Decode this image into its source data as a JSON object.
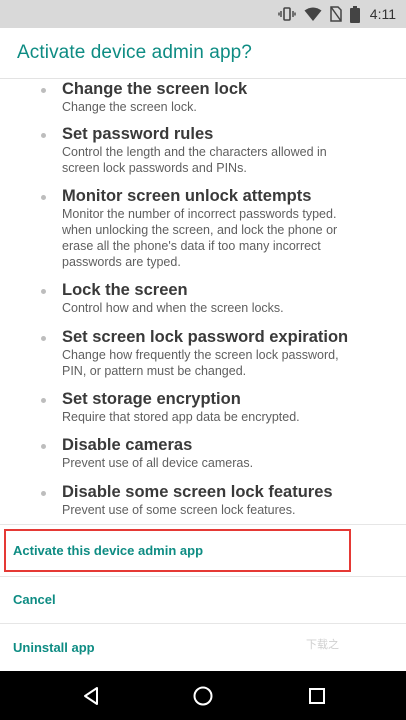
{
  "status_bar": {
    "time": "4:11",
    "icons": [
      "vibrate-icon",
      "wifi-icon",
      "no-sim-icon",
      "battery-icon"
    ]
  },
  "dialog": {
    "title": "Activate device admin app?",
    "permissions": [
      {
        "title": "Change the screen lock",
        "desc": [
          "Change the screen lock."
        ]
      },
      {
        "title": "Set password rules",
        "desc": [
          "Control the length and the characters allowed in",
          "screen lock passwords and PINs."
        ]
      },
      {
        "title": "Monitor screen unlock attempts",
        "desc": [
          "Monitor the number of incorrect passwords typed.",
          "when unlocking the screen, and lock the phone or",
          "erase all the phone's data if too many incorrect",
          "passwords are typed."
        ]
      },
      {
        "title": "Lock the screen",
        "desc": [
          "Control how and when the screen locks."
        ]
      },
      {
        "title": "Set screen lock password expiration",
        "desc": [
          "Change how frequently the screen lock password,",
          "PIN, or pattern must be changed."
        ]
      },
      {
        "title": "Set storage encryption",
        "desc": [
          "Require that stored app data be encrypted."
        ]
      },
      {
        "title": "Disable cameras",
        "desc": [
          "Prevent use of all device cameras."
        ]
      },
      {
        "title": "Disable some screen lock features",
        "desc": [
          "Prevent use of some screen lock features."
        ]
      }
    ],
    "actions": {
      "activate": "Activate this device admin app",
      "cancel": "Cancel",
      "uninstall": "Uninstall app"
    },
    "highlight_color": "#e53935",
    "accent_color": "#0e8c83"
  },
  "watermark": "下载之",
  "nav_bar": {
    "icons": [
      "back-icon",
      "home-icon",
      "recents-icon"
    ]
  }
}
